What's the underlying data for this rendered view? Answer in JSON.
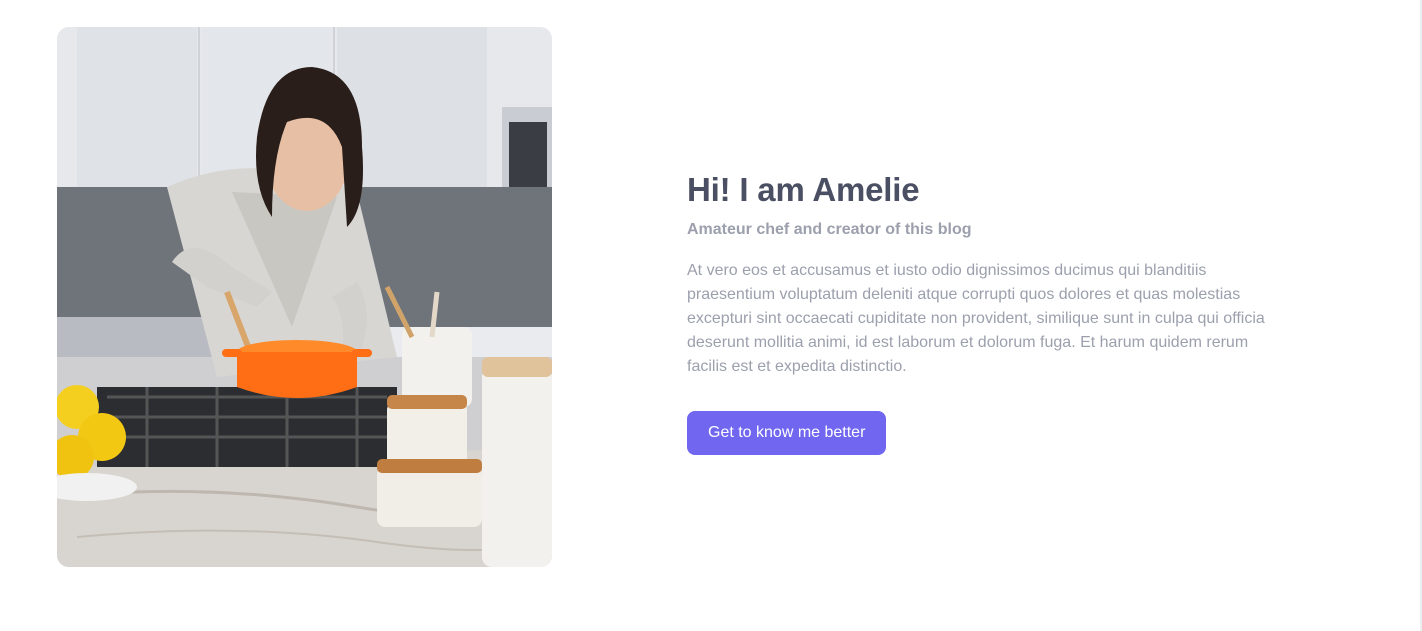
{
  "about": {
    "title": "Hi! I am Amelie",
    "subtitle": "Amateur chef and creator of this blog",
    "body": "At vero eos et accusamus et iusto odio dignissimos ducimus qui blanditiis praesentium voluptatum deleniti atque corrupti quos dolores et quas molestias excepturi sint occaecati cupiditate non provident, similique sunt in culpa qui officia deserunt mollitia animi, id est laborum et dolorum fuga. Et harum quidem rerum facilis est et expedita distinctio.",
    "cta_label": "Get to know me better"
  },
  "colors": {
    "title": "#4b4f63",
    "muted_text": "#9ca0ad",
    "accent": "#7066f0",
    "background": "#ffffff"
  }
}
